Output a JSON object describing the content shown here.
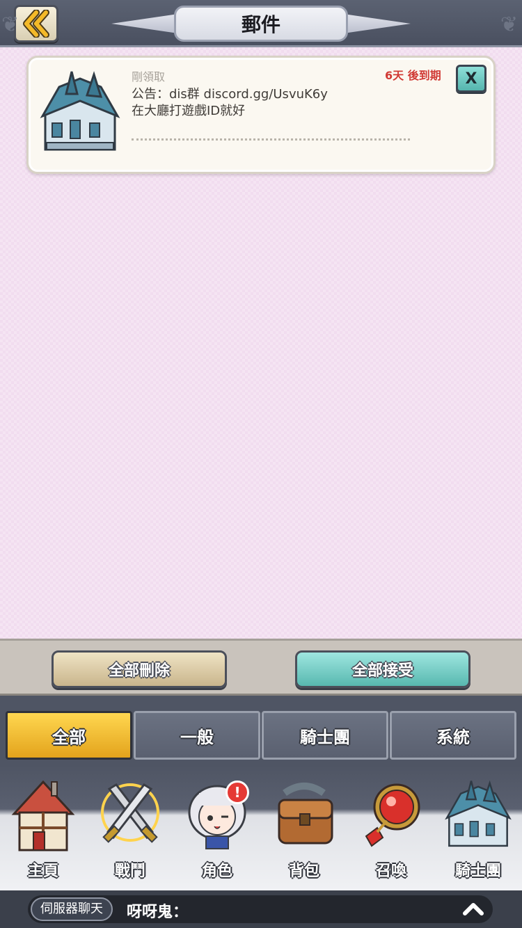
{
  "header": {
    "title": "郵件",
    "back_icon": "double-chevron-left-icon"
  },
  "mail": {
    "items": [
      {
        "status": "剛領取",
        "line1": "公告：dis群 discord.gg/UsvuK6y",
        "line2": "在大廳打遊戲ID就好",
        "expiry": "6天 後到期",
        "close_label": "X",
        "icon": "guild-hall-icon"
      }
    ]
  },
  "actions": {
    "delete_all": "全部刪除",
    "accept_all": "全部接受"
  },
  "filters": {
    "tabs": [
      {
        "label": "全部",
        "active": true
      },
      {
        "label": "一般",
        "active": false
      },
      {
        "label": "騎士團",
        "active": false
      },
      {
        "label": "系統",
        "active": false
      }
    ]
  },
  "nav": {
    "items": [
      {
        "label": "主頁",
        "icon": "house-icon"
      },
      {
        "label": "戰鬥",
        "icon": "crossed-swords-icon"
      },
      {
        "label": "角色",
        "icon": "character-icon"
      },
      {
        "label": "背包",
        "icon": "bag-icon"
      },
      {
        "label": "召喚",
        "icon": "summon-orb-icon"
      },
      {
        "label": "騎士團",
        "icon": "guild-hall-icon"
      }
    ],
    "badge": "!"
  },
  "chat": {
    "channel": "伺服器聊天",
    "message": "呀呀鬼：",
    "expand_icon": "chevron-up-icon"
  },
  "colors": {
    "mail_bg": "#f1dcef",
    "expiry_red": "#d13a35",
    "accept_teal": "#58b8b0",
    "active_tab_gold": "#e3a31c"
  }
}
